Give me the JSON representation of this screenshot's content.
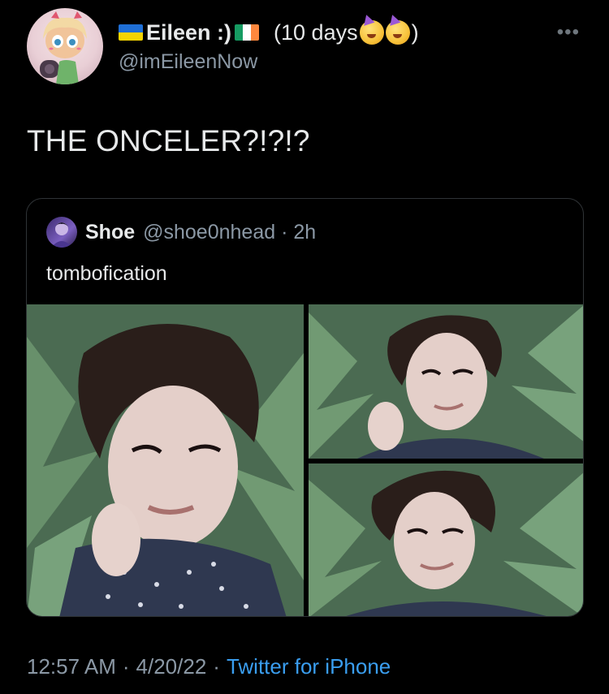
{
  "author": {
    "display_name": "Eileen :)",
    "days_label": "(10 days",
    "days_close": ")",
    "handle": "@imEileenNow",
    "flag_left_colors": [
      "#1f6fd6",
      "#f5d400"
    ],
    "flag_right_colors": [
      "#169b62",
      "#ffffff",
      "#ff883e"
    ],
    "emoji_names": [
      "party-face-emoji",
      "party-face-emoji"
    ]
  },
  "tweet": {
    "text": "THE ONCELER?!?!?",
    "more_icon": "•••"
  },
  "quote": {
    "name": "Shoe",
    "handle_time": "@shoe0nhead · 2h",
    "text": "tombofication"
  },
  "footer": {
    "time": "12:57 AM",
    "sep1": "·",
    "date": "4/20/22",
    "sep2": "·",
    "source": "Twitter for iPhone"
  },
  "colors": {
    "background": "#000000",
    "text_primary": "#e7e9ea",
    "text_secondary": "#8b98a5",
    "link": "#3a9ef0",
    "border": "#2f3336"
  }
}
